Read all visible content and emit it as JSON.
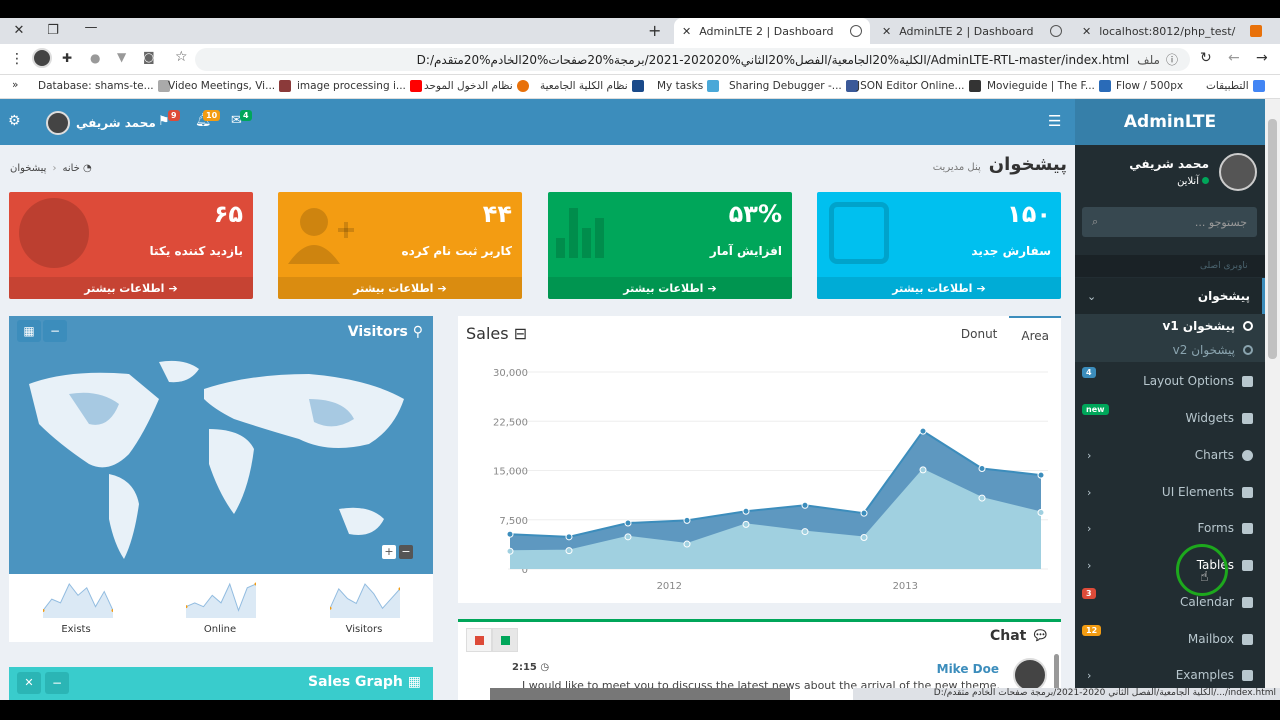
{
  "browser": {
    "tabs": [
      {
        "title": "AdminLTE 2 | Dashboard",
        "active": true
      },
      {
        "title": "AdminLTE 2 | Dashboard",
        "active": false
      },
      {
        "title": "localhost:8012/php_test/",
        "active": false
      }
    ],
    "address": "D:/الكلية%20الجامعية/الفصل%20الثاني%202020-2021/برمجة%20صفحات%20الخادم%20متقدم/AdminLTE-RTL-master/index.html",
    "address_prefix": "ملف",
    "bookmarks": [
      "Database: shams-te...",
      "Video Meetings, Vi...",
      "image processing i...",
      "نظام الدخول الموحد",
      "نظام الكلية الجامعية",
      "My tasks",
      "Sharing Debugger -...",
      "JSON Editor Online...",
      "Movieguide | The F...",
      "Flow / 500px",
      "التطبيقات"
    ],
    "status_url": "D:/الكلية الجامعية/الفصل الثاني 2020-2021/برمجة صفحات الخادم متقدم/.../index.html"
  },
  "header": {
    "user_name": "محمد شريفي",
    "flag_badge": "9",
    "bell_badge": "10",
    "mail_badge": "4",
    "logo": "AdminLTE"
  },
  "sidebar": {
    "user_name": "محمد شريفي",
    "status": "آنلاین",
    "search_placeholder": "جستوجو ...",
    "section_header": "ناوبری اصلی",
    "items": [
      {
        "label": "پیشخوان"
      },
      {
        "label": "Layout Options",
        "badge": "4"
      },
      {
        "label": "Widgets",
        "badge": "new"
      },
      {
        "label": "Charts"
      },
      {
        "label": "UI Elements"
      },
      {
        "label": "Forms"
      },
      {
        "label": "Tables"
      },
      {
        "label": "Calendar",
        "badge": "3"
      },
      {
        "label": "Mailbox",
        "badge": "12"
      },
      {
        "label": "Examples"
      }
    ],
    "sub_items": [
      "پیشخوان v1",
      "پیشخوان v2"
    ]
  },
  "content": {
    "title": "پیشخوان",
    "subtitle": "پنل مدیریت",
    "breadcrumb_home": "خانه",
    "breadcrumb_current": "پیشخوان"
  },
  "boxes": [
    {
      "number": "۱۵۰",
      "text": "سفارش جدید",
      "footer": "اطلاعات بیشتر",
      "color": "#00c0ef"
    },
    {
      "number": "۵۳%",
      "text": "افزایش آمار",
      "footer": "اطلاعات بیشتر",
      "color": "#00a65a"
    },
    {
      "number": "۴۴",
      "text": "کاربر ثبت نام کرده",
      "footer": "اطلاعات بیشتر",
      "color": "#f39c12"
    },
    {
      "number": "۶۵",
      "text": "بازدید کننده یکتا",
      "footer": "اطلاعات بیشتر",
      "color": "#dd4b39"
    }
  ],
  "visitors": {
    "title": "Visitors",
    "sparklines": [
      {
        "label": "Exists",
        "values": [
          2,
          5,
          4,
          9,
          6,
          8,
          3,
          7,
          2
        ]
      },
      {
        "label": "Online",
        "values": [
          3,
          4,
          3,
          6,
          4,
          9,
          2,
          8,
          9
        ]
      },
      {
        "label": "Visitors",
        "values": [
          2,
          6,
          4,
          3,
          7,
          5,
          2,
          4,
          6
        ]
      }
    ]
  },
  "sales": {
    "title": "Sales",
    "tab_area": "Area",
    "tab_donut": "Donut"
  },
  "chart_data": {
    "type": "area",
    "y_ticks": [
      "30,000",
      "22,500",
      "15,000",
      "7,500",
      "0"
    ],
    "x_ticks": [
      "2012",
      "2013"
    ],
    "ylim": [
      0,
      30000
    ],
    "series": [
      {
        "values": [
          5300,
          4900,
          7000,
          7400,
          8800,
          9700,
          8500,
          21000,
          15300,
          14300
        ]
      },
      {
        "values": [
          2700,
          2800,
          4900,
          3800,
          6800,
          5700,
          4800,
          15100,
          10800,
          8600
        ]
      }
    ]
  },
  "chat": {
    "title": "Chat",
    "sender": "Mike Doe",
    "time": "2:15",
    "message": "I would like to meet you to discuss the latest news about the arrival of the new theme. They say it"
  },
  "sales_graph": {
    "title": "Sales Graph"
  }
}
